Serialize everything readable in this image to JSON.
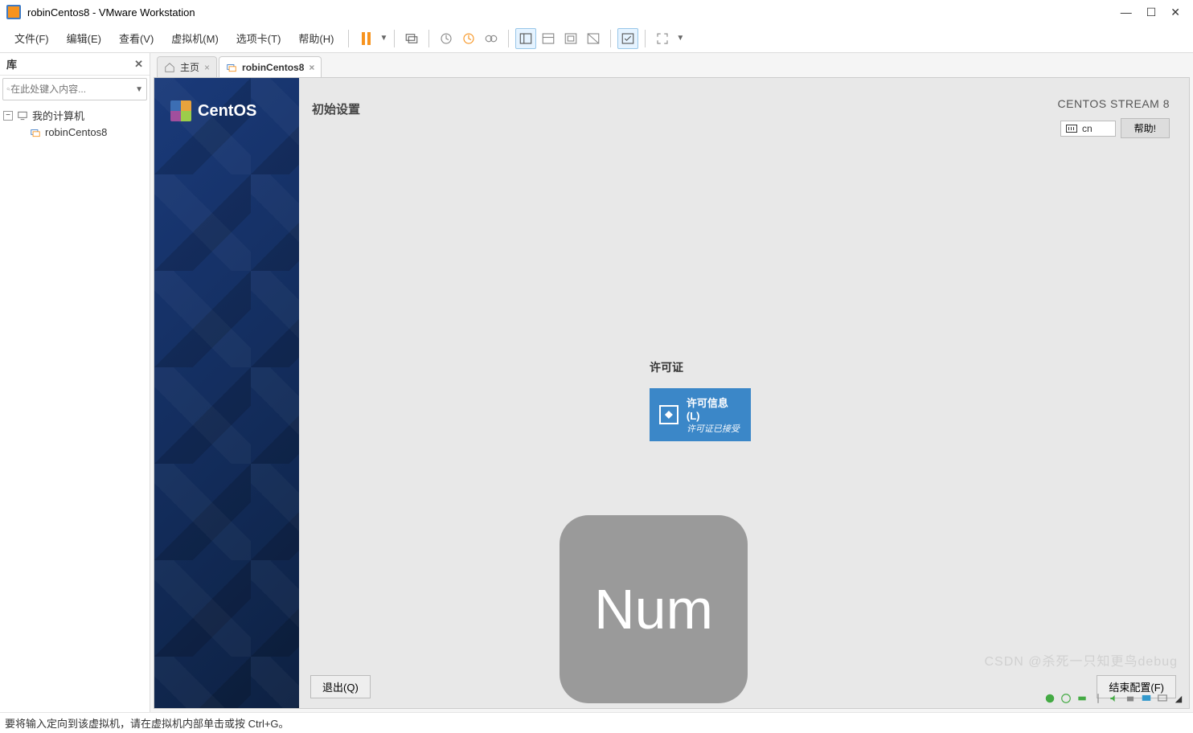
{
  "window": {
    "title": "robinCentos8 - VMware Workstation",
    "controls": {
      "min": "—",
      "max": "☐",
      "close": "✕"
    }
  },
  "menu": {
    "file": "文件(F)",
    "edit": "编辑(E)",
    "view": "查看(V)",
    "vm": "虚拟机(M)",
    "tabs": "选项卡(T)",
    "help": "帮助(H)"
  },
  "sidebar": {
    "title": "库",
    "search_placeholder": "在此处键入内容...",
    "tree": {
      "root": "我的计算机",
      "child": "robinCentos8"
    }
  },
  "tabs": {
    "home": "主页",
    "vm": "robinCentos8"
  },
  "centos": {
    "brand": "CentOS",
    "init_title": "初始设置",
    "stream_title": "CENTOS STREAM 8",
    "lang": "cn",
    "help_btn": "帮助!",
    "license": {
      "section_label": "许可证",
      "title": "许可信息(L)",
      "subtitle": "许可证已接受"
    },
    "overlay": "Num",
    "exit_btn": "退出(Q)",
    "finish_btn": "结束配置(F)"
  },
  "statusbar": "要将输入定向到该虚拟机，请在虚拟机内部单击或按 Ctrl+G。",
  "watermark": "CSDN @杀死一只知更鸟debug"
}
